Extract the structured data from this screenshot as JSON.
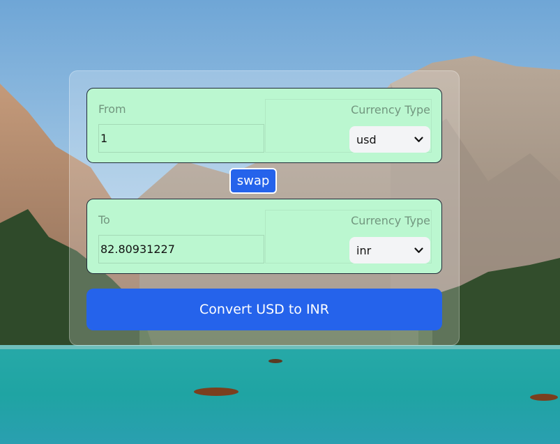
{
  "from": {
    "label": "From",
    "amount": "1",
    "currency_label": "Currency Type",
    "currency": "usd"
  },
  "swap_label": "swap",
  "to": {
    "label": "To",
    "amount": "82.80931227",
    "currency_label": "Currency Type",
    "currency": "inr"
  },
  "convert_label": "Convert USD to INR",
  "colors": {
    "panel_bg": "#bbf7d0",
    "button_blue": "#2563eb",
    "select_bg": "#f3f4f6"
  },
  "icons": {
    "dropdown": "chevron-down-icon"
  }
}
